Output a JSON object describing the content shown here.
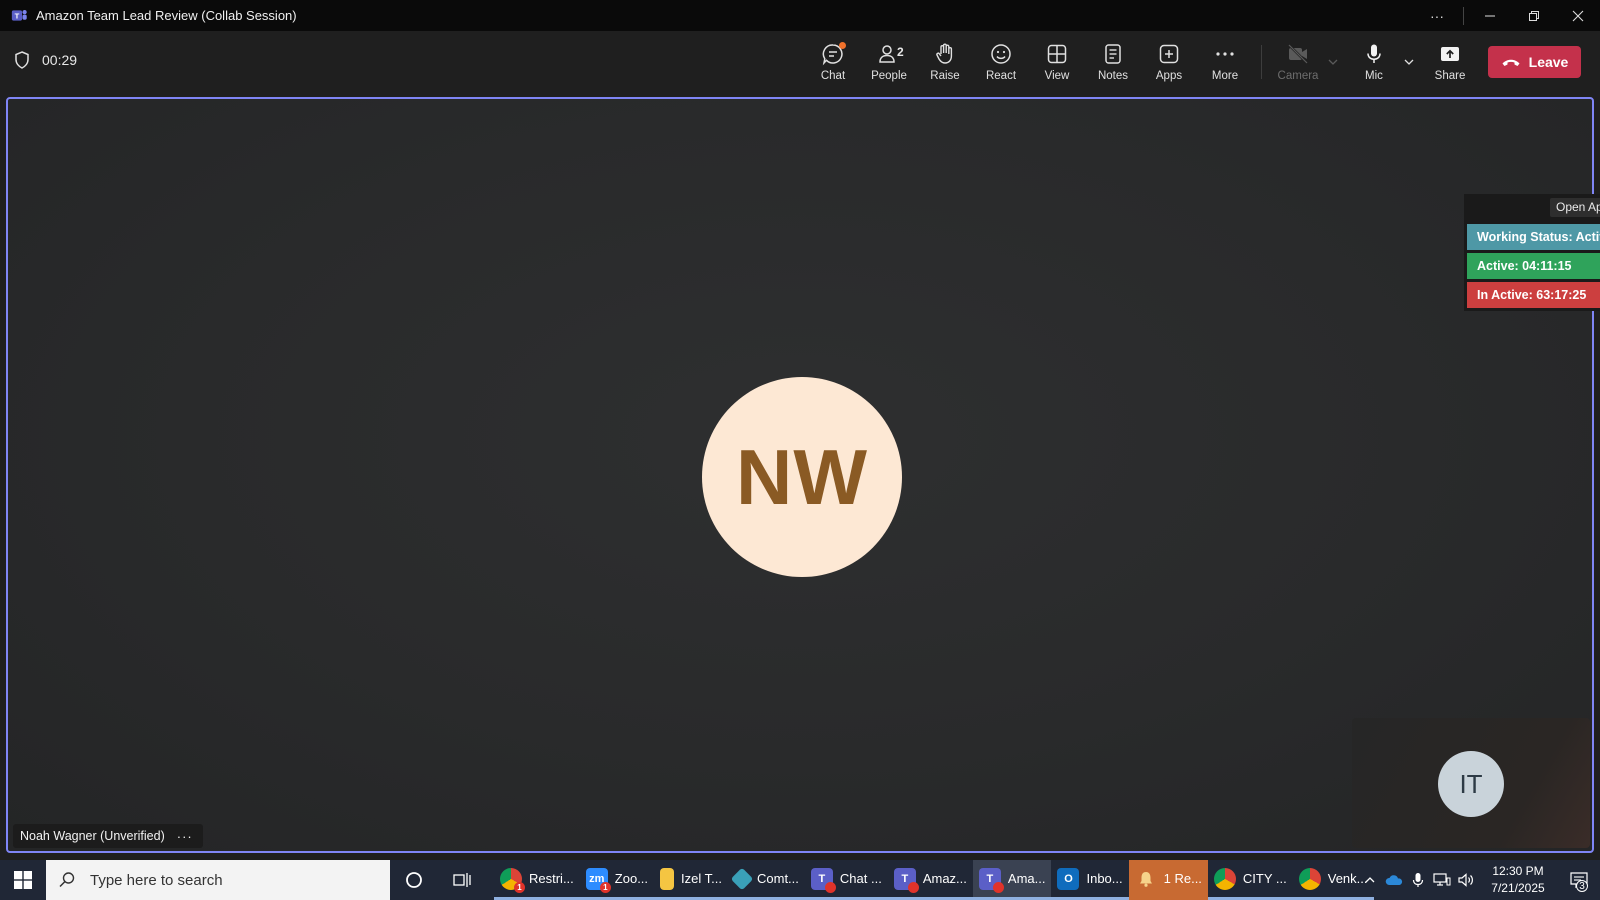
{
  "window": {
    "title": "Amazon Team Lead Review (Collab Session)"
  },
  "meeting": {
    "timer": "00:29",
    "toolbar": {
      "chat": "Chat",
      "people": "People",
      "people_count": "2",
      "raise": "Raise",
      "react": "React",
      "view": "View",
      "notes": "Notes",
      "apps": "Apps",
      "more": "More",
      "camera": "Camera",
      "mic": "Mic",
      "share": "Share",
      "leave": "Leave"
    },
    "main_participant": {
      "initials": "NW",
      "name_tag": "Noah Wagner (Unverified)"
    },
    "self_view": {
      "initials": "IT"
    }
  },
  "status_widget": {
    "open_app": "Open App",
    "working_status": "Working Status: Active",
    "active": "Active: 04:11:15",
    "inactive": "In Active: 63:17:25",
    "colors": {
      "working": "#4e98a6",
      "active": "#2fa35b",
      "inactive": "#cc3f3f"
    }
  },
  "taskbar": {
    "search_placeholder": "Type here to search",
    "items": [
      {
        "label": "Restri...",
        "icon": "chrome-icon",
        "badge": "1"
      },
      {
        "label": "Zoo...",
        "icon": "zoom-icon",
        "badge": "1"
      },
      {
        "label": "Izel T...",
        "icon": "folder-icon"
      },
      {
        "label": "Comt...",
        "icon": "comtrack-icon"
      },
      {
        "label": "Chat ...",
        "icon": "teams-icon"
      },
      {
        "label": "Amaz...",
        "icon": "teams-icon"
      },
      {
        "label": "Ama...",
        "icon": "teams-icon"
      },
      {
        "label": "Inbo...",
        "icon": "outlook-icon"
      },
      {
        "label": "1 Re...",
        "icon": "bell-icon"
      },
      {
        "label": "CITY ...",
        "icon": "chrome-icon"
      },
      {
        "label": "Venk...",
        "icon": "chrome-icon"
      }
    ],
    "clock": {
      "time": "12:30 PM",
      "date": "7/21/2025"
    },
    "notifications": "3"
  }
}
